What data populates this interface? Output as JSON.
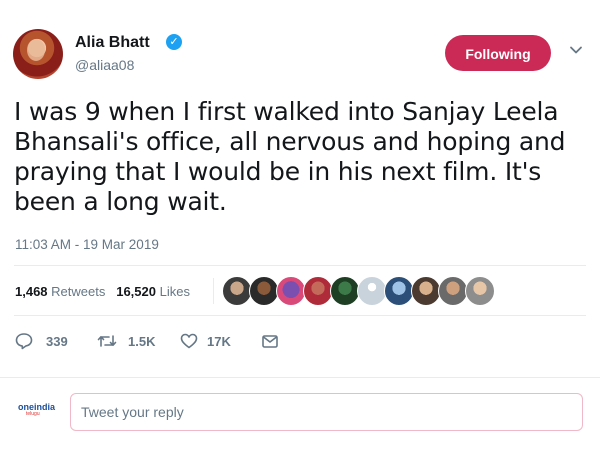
{
  "author": {
    "display_name": "Alia Bhatt",
    "handle": "@aliaa08",
    "verified_icon": "verified-badge-icon",
    "verified_color": "#1da1f2"
  },
  "follow_button": {
    "label": "Following",
    "color": "#cb2a57"
  },
  "tweet": {
    "text": "I was 9 when I first walked into Sanjay Leela Bhansali's office, all nervous and hoping and praying that I would be in his next film. It's been a long wait.",
    "timestamp": "11:03 AM - 19 Mar 2019"
  },
  "stats": {
    "retweets_count": "1,468",
    "retweets_label": "Retweets",
    "likes_count": "16,520",
    "likes_label": "Likes"
  },
  "likers": [
    "liker-avatar",
    "liker-avatar",
    "liker-avatar",
    "liker-avatar",
    "liker-avatar",
    "liker-avatar",
    "liker-avatar",
    "liker-avatar",
    "liker-avatar",
    "liker-avatar"
  ],
  "actions": {
    "replies": "339",
    "retweets": "1.5K",
    "likes": "17K"
  },
  "reply": {
    "placeholder": "Tweet your reply"
  },
  "watermark": {
    "brand": "oneindia",
    "sub": "telugu"
  },
  "colors": {
    "secondary_text": "#657786",
    "divider": "#e6ecf0"
  }
}
